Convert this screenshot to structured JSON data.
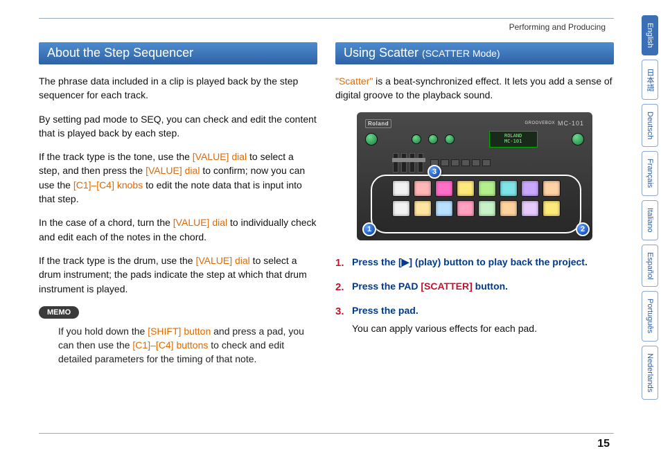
{
  "header": {
    "breadcrumb": "Performing and Producing"
  },
  "left": {
    "heading": "About the Step Sequencer",
    "p1": "The phrase data included in a clip is played back by the step sequencer for each track.",
    "p2": "By setting pad mode to SEQ, you can check and edit the content that is played back by each step.",
    "p3a": "If the track type is the tone, use the ",
    "p3_v1": "[VALUE] dial",
    "p3b": " to select a step, and then press the ",
    "p3_v2": "[VALUE] dial",
    "p3c": " to confirm; now you can use the ",
    "p3_v3": "[C1]–[C4] knobs",
    "p3d": " to edit the note data that is input into that step.",
    "p4a": "In the case of a chord, turn the ",
    "p4_v": "[VALUE] dial",
    "p4b": " to individually check and edit each of the notes in the chord.",
    "p5a": "If the track type is the drum, use the ",
    "p5_v": "[VALUE] dial",
    "p5b": " to select a drum instrument; the pads indicate the step at which that drum instrument is played.",
    "memo_label": "MEMO",
    "memo_a": "If you hold down the ",
    "memo_shift": "[SHIFT] button",
    "memo_b": " and press a pad, you can then use the ",
    "memo_c": "[C1]–[C4] buttons",
    "memo_d": " to check and edit detailed parameters for the timing of that note."
  },
  "right": {
    "heading_main": "Using Scatter ",
    "heading_sub": "(SCATTER Mode)",
    "intro_term": "\"Scatter\"",
    "intro_rest": " is a beat-synchronized effect. It lets you add a sense of digital groove to the playback sound.",
    "device": {
      "brand": "Roland",
      "label_groovebox": "GROOVEBOX",
      "model": "MC-101",
      "display_l1": "ROLAND",
      "display_l2": "MC-101",
      "callouts": {
        "c1": "1",
        "c2": "2",
        "c3": "3"
      },
      "pad_colors_row1": [
        "#f2f2f2",
        "#ffb6b6",
        "#ff6ec7",
        "#ffe97a",
        "#b3f08c",
        "#7fe3e8",
        "#c9a7ff",
        "#ffd2a6"
      ],
      "pad_colors_row2": [
        "#f2f2f2",
        "#ffe6a0",
        "#b8e0ff",
        "#ffa0c0",
        "#c7f2c7",
        "#ffd29e",
        "#e6c9ff",
        "#ffe97a"
      ]
    },
    "steps": {
      "s1_num": "1.",
      "s1a": "Press the ",
      "s1_btn": "[▶] (play) button",
      "s1b": " to play back the project.",
      "s2_num": "2.",
      "s2a": "Press the PAD ",
      "s2_btn": "[SCATTER]",
      "s2b": " button.",
      "s3_num": "3.",
      "s3a": "Press the pad.",
      "s3_sub": "You can apply various effects for each pad."
    }
  },
  "langs": [
    "English",
    "日本語",
    "Deutsch",
    "Français",
    "Italiano",
    "Español",
    "Português",
    "Nederlands"
  ],
  "page_number": "15"
}
